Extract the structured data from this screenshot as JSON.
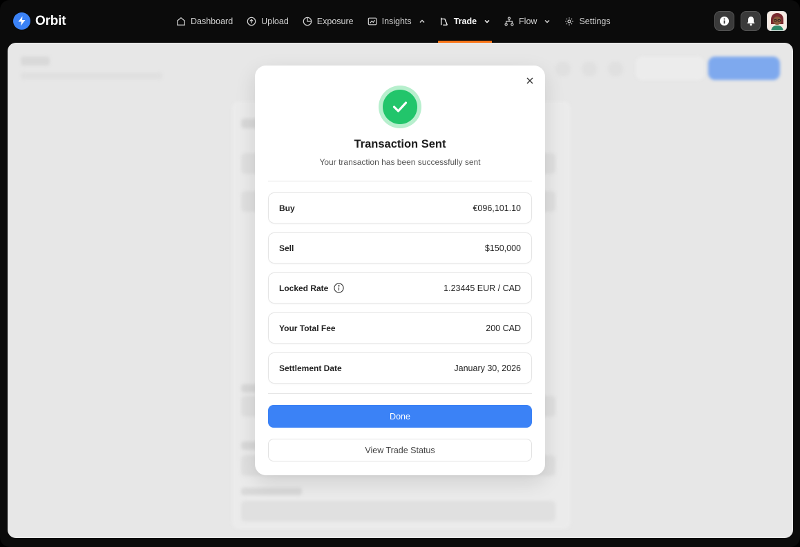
{
  "app": {
    "name": "Orbit"
  },
  "nav": {
    "items": [
      {
        "label": "Dashboard",
        "icon": "home-icon",
        "active": false
      },
      {
        "label": "Upload",
        "icon": "upload-icon",
        "active": false
      },
      {
        "label": "Exposure",
        "icon": "pie-chart-icon",
        "active": false
      },
      {
        "label": "Insights",
        "icon": "image-chart-icon",
        "active": false,
        "dropdown": "chevron-up-icon"
      },
      {
        "label": "Trade",
        "icon": "trade-icon",
        "active": true,
        "dropdown": "chevron-down-icon"
      },
      {
        "label": "Flow",
        "icon": "flow-icon",
        "active": false,
        "dropdown": "chevron-down-icon"
      },
      {
        "label": "Settings",
        "icon": "gear-icon",
        "active": false
      }
    ],
    "active_indicator_color": "#f97316"
  },
  "modal": {
    "title": "Transaction Sent",
    "subtitle": "Your transaction has been successfully sent",
    "rows": [
      {
        "label": "Buy",
        "value": "€096,101.10"
      },
      {
        "label": "Sell",
        "value": "$150,000"
      },
      {
        "label": "Locked Rate",
        "value": "1.23445 EUR / CAD",
        "info_icon": true
      },
      {
        "label": "Your Total Fee",
        "value": "200 CAD"
      },
      {
        "label": "Settlement Date",
        "value": "January 30, 2026"
      }
    ],
    "primary_button": "Done",
    "secondary_button": "View Trade Status"
  },
  "colors": {
    "primary": "#3b82f6",
    "success": "#22c56b",
    "topbar": "#0b0b0b"
  }
}
